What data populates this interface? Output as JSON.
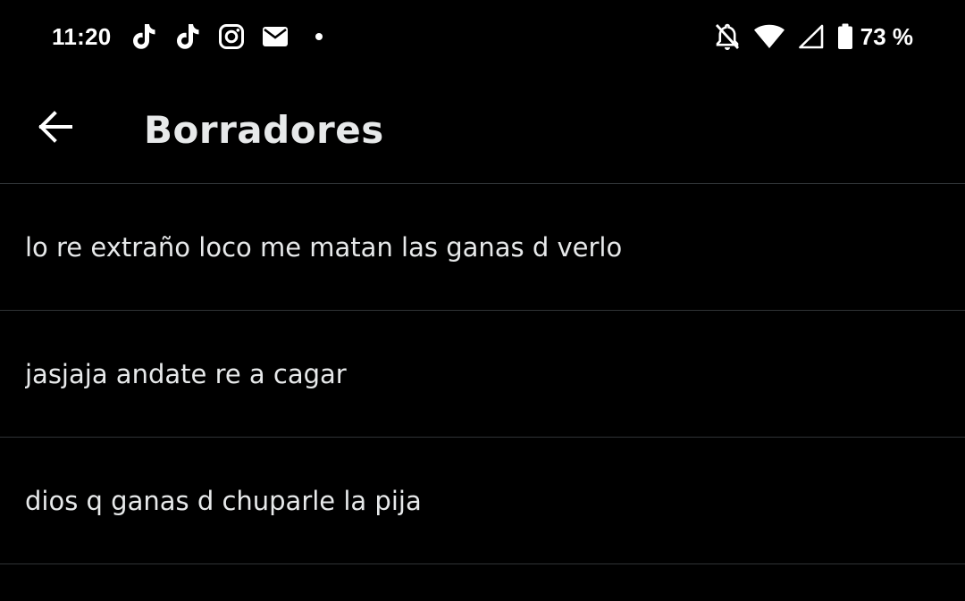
{
  "status_bar": {
    "time": "11:20",
    "notification_icons": [
      "tiktok-icon",
      "tiktok-icon",
      "instagram-icon",
      "mail-icon",
      "more-notifications-dot-icon"
    ],
    "system_icons": [
      "bell-off-icon",
      "wifi-icon",
      "cellular-signal-icon",
      "battery-icon"
    ],
    "battery_percent": "73 %"
  },
  "header": {
    "back_icon": "arrow-left-icon",
    "title": "Borradores"
  },
  "drafts": [
    {
      "text": "lo re extraño loco me matan las ganas d verlo"
    },
    {
      "text": "jasjaja andate re a cagar"
    },
    {
      "text": "dios q ganas d chuparle la pija"
    }
  ],
  "colors": {
    "background": "#000000",
    "text": "#e7e9ea",
    "divider": "#2f3336",
    "status_icons": "#ffffff"
  }
}
